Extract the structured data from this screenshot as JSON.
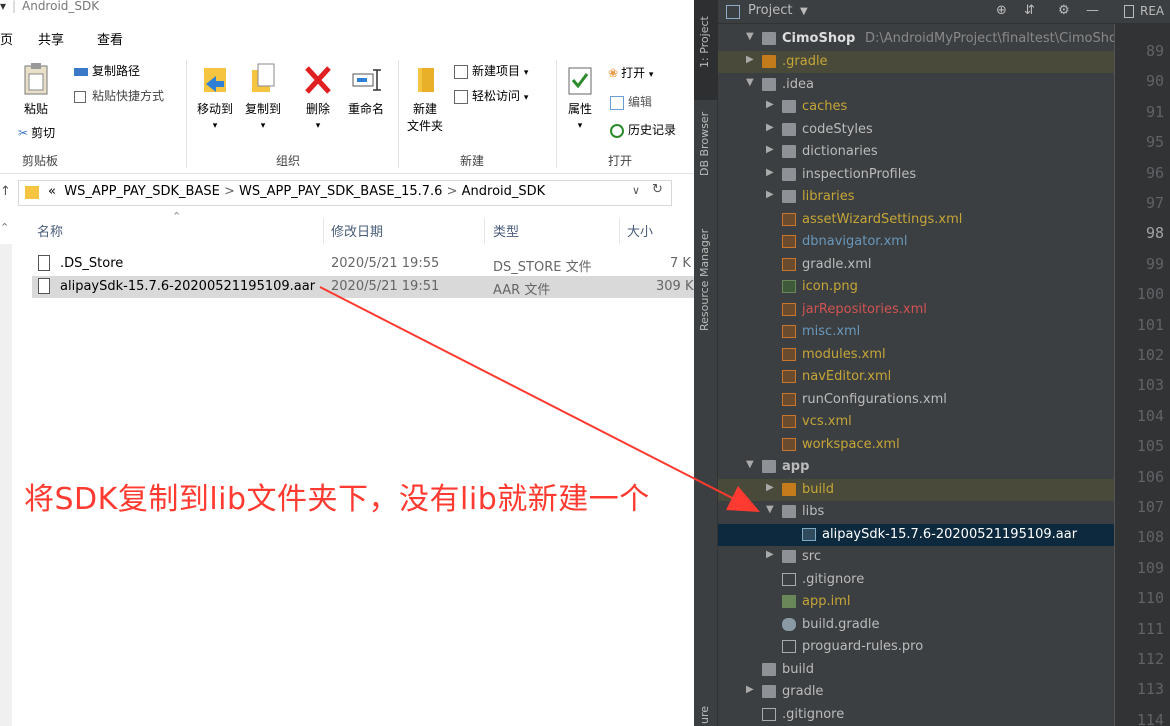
{
  "explorer": {
    "window_title": "Android_SDK",
    "tabs": [
      "页",
      "共享",
      "查看"
    ],
    "ribbon": {
      "clipboard": {
        "paste": "粘贴",
        "copy_path": "复制路径",
        "paste_shortcut": "粘贴快捷方式",
        "cut": "剪切",
        "group": "剪贴板"
      },
      "organize": {
        "move_to": "移动到",
        "copy_to": "复制到",
        "delete": "删除",
        "rename": "重命名",
        "group": "组织"
      },
      "new": {
        "new_folder_line1": "新建",
        "new_folder_line2": "文件夹",
        "new_item": "新建项目",
        "easy_access": "轻松访问",
        "group": "新建"
      },
      "open": {
        "properties": "属性",
        "open": "打开",
        "edit": "编辑",
        "history": "历史记录",
        "group": "打开"
      }
    },
    "address": {
      "prefix": "«",
      "crumbs": [
        "WS_APP_PAY_SDK_BASE",
        "WS_APP_PAY_SDK_BASE_15.7.6",
        "Android_SDK"
      ],
      "separator": ">"
    },
    "columns": [
      "名称",
      "修改日期",
      "类型",
      "大小"
    ],
    "files": [
      {
        "name": ".DS_Store",
        "date": "2020/5/21 19:55",
        "type": "DS_STORE 文件",
        "size": "7 K"
      },
      {
        "name": "alipaySdk-15.7.6-20200521195109.aar",
        "date": "2020/5/21 19:51",
        "type": "AAR 文件",
        "size": "309 K"
      }
    ],
    "annotation": "将SDK复制到lib文件夹下，没有lib就新建一个"
  },
  "ide": {
    "side_tabs": [
      "1: Project",
      "DB Browser",
      "Resource Manager",
      "ure"
    ],
    "panel_title": "Project",
    "editor_tab": "REA",
    "root": {
      "name": "CimoShop",
      "path": "D:\\AndroidMyProject\\finaltest\\CimoShop"
    },
    "tree": [
      {
        "label": ".gradle",
        "color": "#c5a537"
      },
      {
        "label": ".idea",
        "color": "#bbbbbb"
      },
      {
        "label": "caches",
        "color": "#c5a537"
      },
      {
        "label": "codeStyles",
        "color": "#bbbbbb"
      },
      {
        "label": "dictionaries",
        "color": "#bbbbbb"
      },
      {
        "label": "inspectionProfiles",
        "color": "#bbbbbb"
      },
      {
        "label": "libraries",
        "color": "#c5a537"
      },
      {
        "label": "assetWizardSettings.xml",
        "color": "#c5a537"
      },
      {
        "label": "dbnavigator.xml",
        "color": "#6897bb"
      },
      {
        "label": "gradle.xml",
        "color": "#bbbbbb"
      },
      {
        "label": "icon.png",
        "color": "#c5a537"
      },
      {
        "label": "jarRepositories.xml",
        "color": "#d25252"
      },
      {
        "label": "misc.xml",
        "color": "#6897bb"
      },
      {
        "label": "modules.xml",
        "color": "#c5a537"
      },
      {
        "label": "navEditor.xml",
        "color": "#c5a537"
      },
      {
        "label": "runConfigurations.xml",
        "color": "#bbbbbb"
      },
      {
        "label": "vcs.xml",
        "color": "#c5a537"
      },
      {
        "label": "workspace.xml",
        "color": "#c5a537"
      },
      {
        "label": "app",
        "color": "#bbbbbb"
      },
      {
        "label": "build",
        "color": "#c5a537"
      },
      {
        "label": "libs",
        "color": "#bbbbbb"
      },
      {
        "label": "alipaySdk-15.7.6-20200521195109.aar",
        "color": "#ffffff"
      },
      {
        "label": "src",
        "color": "#bbbbbb"
      },
      {
        "label": ".gitignore",
        "color": "#bbbbbb"
      },
      {
        "label": "app.iml",
        "color": "#c5a537"
      },
      {
        "label": "build.gradle",
        "color": "#bbbbbb"
      },
      {
        "label": "proguard-rules.pro",
        "color": "#bbbbbb"
      },
      {
        "label": "build",
        "color": "#bbbbbb"
      },
      {
        "label": "gradle",
        "color": "#bbbbbb"
      },
      {
        "label": ".gitignore",
        "color": "#bbbbbb"
      }
    ],
    "line_numbers": [
      "89",
      "90",
      "91",
      "95",
      "96",
      "97",
      "98",
      "99",
      "100",
      "101",
      "102",
      "103",
      "104",
      "105",
      "106",
      "107",
      "108",
      "109",
      "110",
      "111",
      "112",
      "113",
      "114"
    ],
    "current_line": "98",
    "annotation_color": "#ff3a30"
  }
}
